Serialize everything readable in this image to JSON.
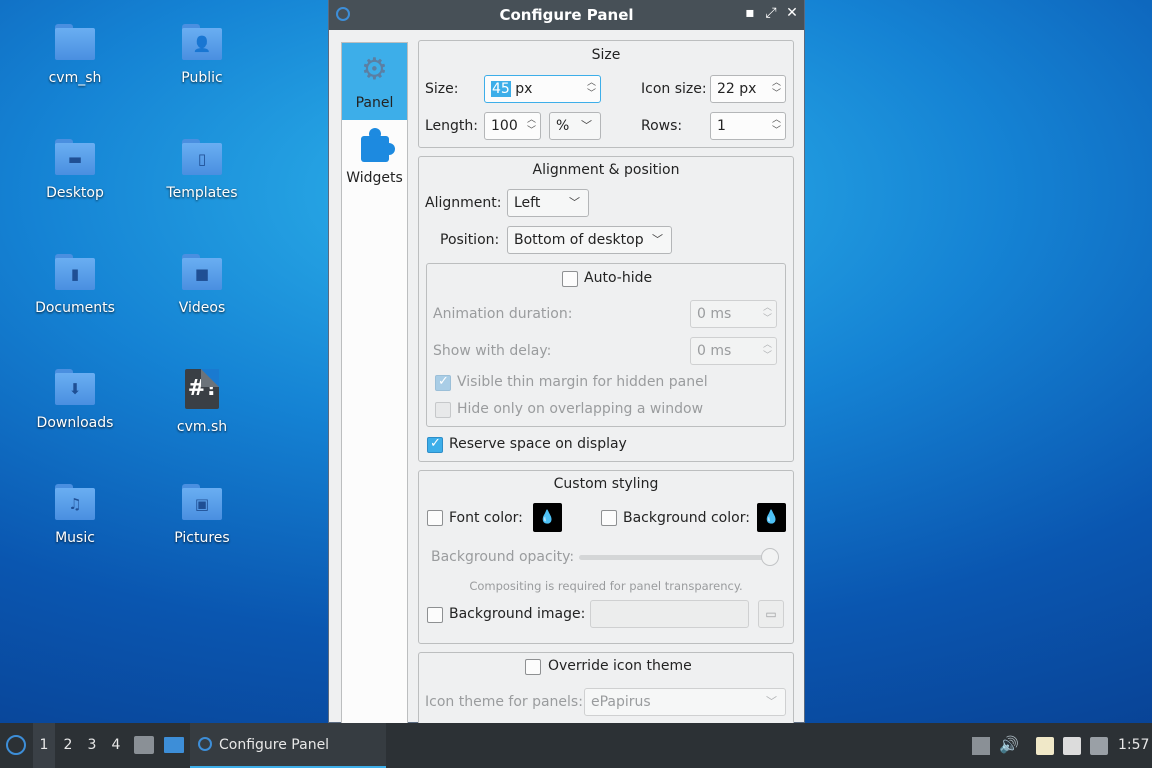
{
  "desktop": {
    "icons": [
      {
        "label": "cvm_sh",
        "icon": "folder-icon",
        "glyph": ""
      },
      {
        "label": "Public",
        "icon": "folder-public-icon",
        "glyph": "👤"
      },
      {
        "label": "Desktop",
        "icon": "folder-desktop-icon",
        "glyph": "▬"
      },
      {
        "label": "Templates",
        "icon": "folder-templates-icon",
        "glyph": "▯"
      },
      {
        "label": "Documents",
        "icon": "folder-documents-icon",
        "glyph": "▮"
      },
      {
        "label": "Videos",
        "icon": "folder-videos-icon",
        "glyph": "■"
      },
      {
        "label": "Downloads",
        "icon": "folder-downloads-icon",
        "glyph": "⬇"
      },
      {
        "label": "cvm.sh",
        "icon": "script-file-icon",
        "glyph": "#!"
      },
      {
        "label": "Music",
        "icon": "folder-music-icon",
        "glyph": "♫"
      },
      {
        "label": "Pictures",
        "icon": "folder-pictures-icon",
        "glyph": "▣"
      }
    ]
  },
  "window": {
    "title": "Configure Panel",
    "controls": {
      "minimize": "▪",
      "maximize": "⤢",
      "close": "✕"
    },
    "sidebar": [
      {
        "label": "Panel",
        "icon": "gear-icon",
        "active": true
      },
      {
        "label": "Widgets",
        "icon": "puzzle-icon",
        "active": false
      }
    ],
    "size": {
      "title": "Size",
      "size_label": "Size:",
      "size_value_selected": "45",
      "size_unit": " px",
      "icon_size_label": "Icon size:",
      "icon_size_value": "22 px",
      "length_label": "Length:",
      "length_value": "100",
      "length_unit": "%",
      "rows_label": "Rows:",
      "rows_value": "1"
    },
    "alignment": {
      "title": "Alignment & position",
      "alignment_label": "Alignment:",
      "alignment_value": "Left",
      "position_label": "Position:",
      "position_value": "Bottom of desktop",
      "autohide_label": "Auto-hide",
      "autohide_checked": false,
      "anim_label": "Animation duration:",
      "anim_value": "0 ms",
      "delay_label": "Show with delay:",
      "delay_value": "0 ms",
      "thin_margin_label": "Visible thin margin for hidden panel",
      "thin_margin_checked": true,
      "overlap_label": "Hide only on overlapping a window",
      "overlap_checked": false,
      "reserve_label": "Reserve space on display",
      "reserve_checked": true
    },
    "styling": {
      "title": "Custom styling",
      "font_color_label": "Font color:",
      "font_color_checked": false,
      "font_color": "#000000",
      "bg_color_label": "Background color:",
      "bg_color_checked": false,
      "bg_color": "#000000",
      "opacity_label": "Background opacity:",
      "opacity_level": 1.0,
      "compositing_note": "Compositing is required for panel transparency.",
      "bg_image_label": "Background image:",
      "bg_image_checked": false,
      "bg_image_value": ""
    },
    "icon_theme": {
      "override_label": "Override icon theme",
      "override_checked": false,
      "theme_label": "Icon theme for panels:",
      "theme_value": "ePapirus"
    }
  },
  "taskbar": {
    "workspaces": [
      "1",
      "2",
      "3",
      "4"
    ],
    "active_workspace": "1",
    "task_label": "Configure Panel",
    "clock": "1:57",
    "accent": "#3daee9"
  }
}
